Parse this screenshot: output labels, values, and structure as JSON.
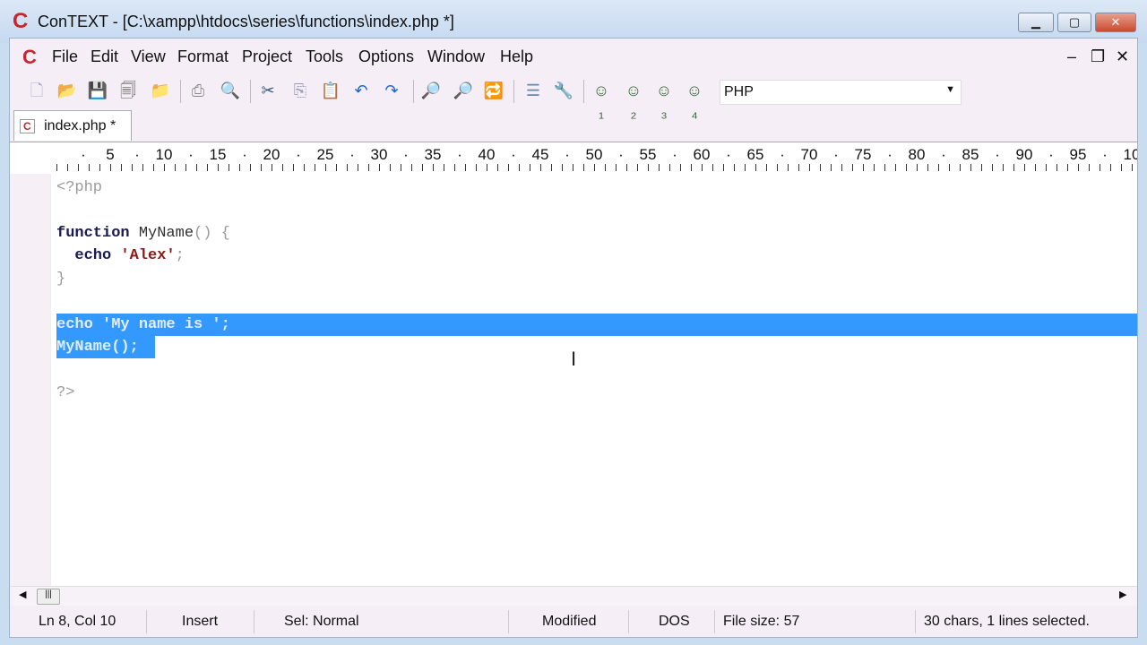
{
  "window": {
    "title": "ConTEXT - [C:\\xampp\\htdocs\\series\\functions\\index.php *]",
    "logo": "C"
  },
  "menu": [
    "File",
    "Edit",
    "View",
    "Format",
    "Project",
    "Tools",
    "Options",
    "Window",
    "Help"
  ],
  "toolbar": {
    "language": "PHP"
  },
  "tab": {
    "label": "index.php *"
  },
  "ruler": [
    "5",
    "10",
    "15",
    "20",
    "25",
    "30",
    "35",
    "40",
    "45",
    "50",
    "55",
    "60",
    "65",
    "70",
    "75",
    "80",
    "85",
    "90",
    "95",
    "10"
  ],
  "code": {
    "l1": "<?php",
    "l3a": "function",
    "l3b": " MyName",
    "l3c": "() {",
    "l4a": "  echo",
    "l4b": " 'Alex'",
    "l4c": ";",
    "l5": "}",
    "l7": "echo 'My name is ';",
    "l8": "MyName();",
    "l10": "?>"
  },
  "status": {
    "pos": "Ln 8, Col 10",
    "mode": "Insert",
    "sel": "Sel: Normal",
    "modified": "Modified",
    "eol": "DOS",
    "size": "File size: 57",
    "selinfo": "30 chars, 1 lines selected."
  }
}
